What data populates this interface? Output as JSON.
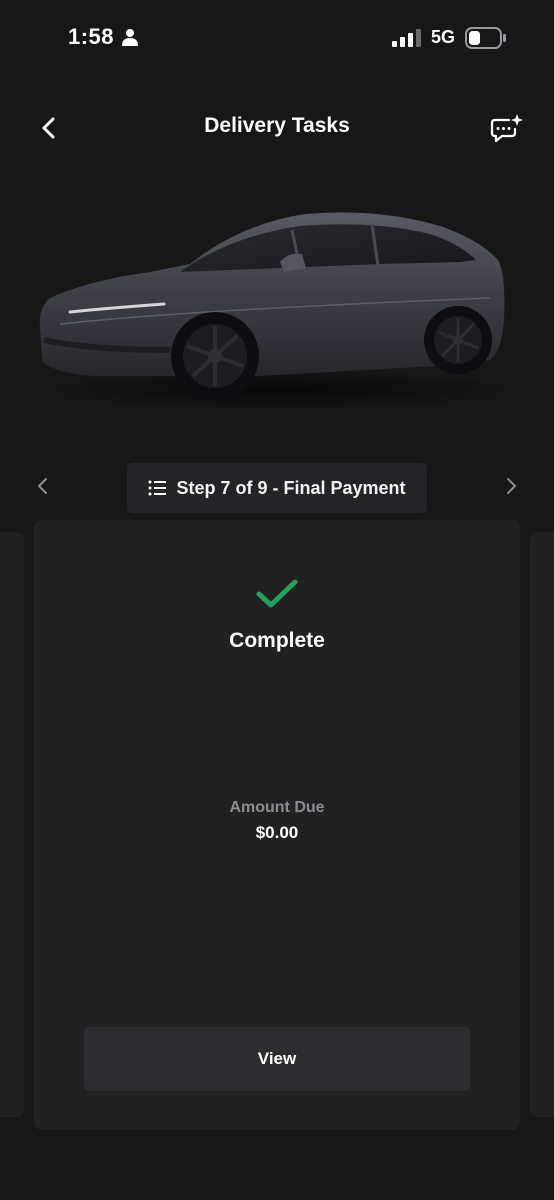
{
  "status_bar": {
    "time": "1:58",
    "network": "5G"
  },
  "header": {
    "title": "Delivery Tasks"
  },
  "step_nav": {
    "label": "Step 7 of 9 - Final Payment",
    "current_step": 7,
    "total_steps": 9
  },
  "task_card": {
    "status": "Complete",
    "amount_label": "Amount Due",
    "amount_value": "$0.00",
    "view_button": "View"
  },
  "colors": {
    "background": "#171718",
    "card": "#212122",
    "button": "#2d2d2f",
    "success": "#1fa35b",
    "muted_text": "#8d8d90"
  },
  "icons": [
    "person-icon",
    "signal-icon",
    "battery-icon",
    "back-chevron-icon",
    "chat-sparkle-icon",
    "list-icon",
    "chevron-left-icon",
    "chevron-right-icon",
    "checkmark-icon"
  ]
}
